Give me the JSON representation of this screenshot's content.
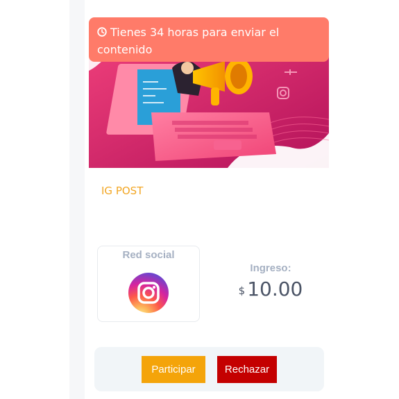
{
  "campaign": {
    "deadline_text": "Tienes 34 horas para enviar el contenido",
    "post_title": "IG POST",
    "social": {
      "label": "Red social",
      "network_icon": "instagram-icon"
    },
    "income": {
      "label": "Ingreso:",
      "currency": "$",
      "amount": "10.00"
    }
  },
  "actions": {
    "participate_label": "Participar",
    "reject_label": "Rechazar"
  },
  "colors": {
    "banner": "#ff7b69",
    "title": "#f2a623",
    "participate": "#f4a40a",
    "reject": "#c40000",
    "hero_background": "#e0256a"
  }
}
